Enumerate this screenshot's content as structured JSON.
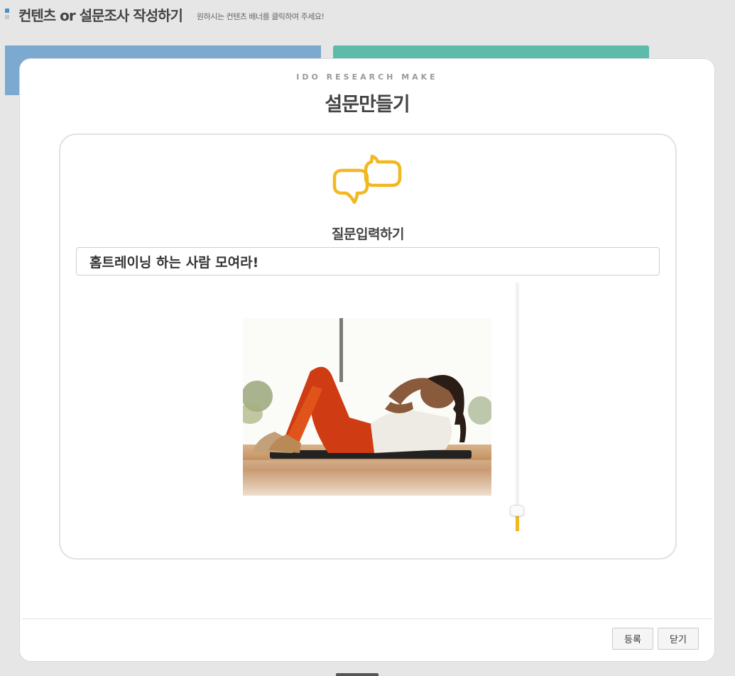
{
  "page": {
    "title": "컨텐츠 or 설문조사 작성하기",
    "subtitle": "원하시는 컨텐츠 배너를 클릭하여 주세요!"
  },
  "modal": {
    "eyebrow": "IDO RESEARCH MAKE",
    "title": "설문만들기",
    "icon": "chat-bubbles-icon",
    "question_label": "질문입력하기",
    "question_value": "홈트레이닝 하는 사람 모여라!",
    "image_alt": "woman doing crunches on a mat",
    "slider": {
      "value_fraction": 0.06
    },
    "buttons": {
      "register": "등록",
      "close": "닫기"
    }
  },
  "colors": {
    "accent": "#f2b822",
    "banner_blue": "#7ba9cf",
    "banner_teal": "#5dbbaa"
  }
}
